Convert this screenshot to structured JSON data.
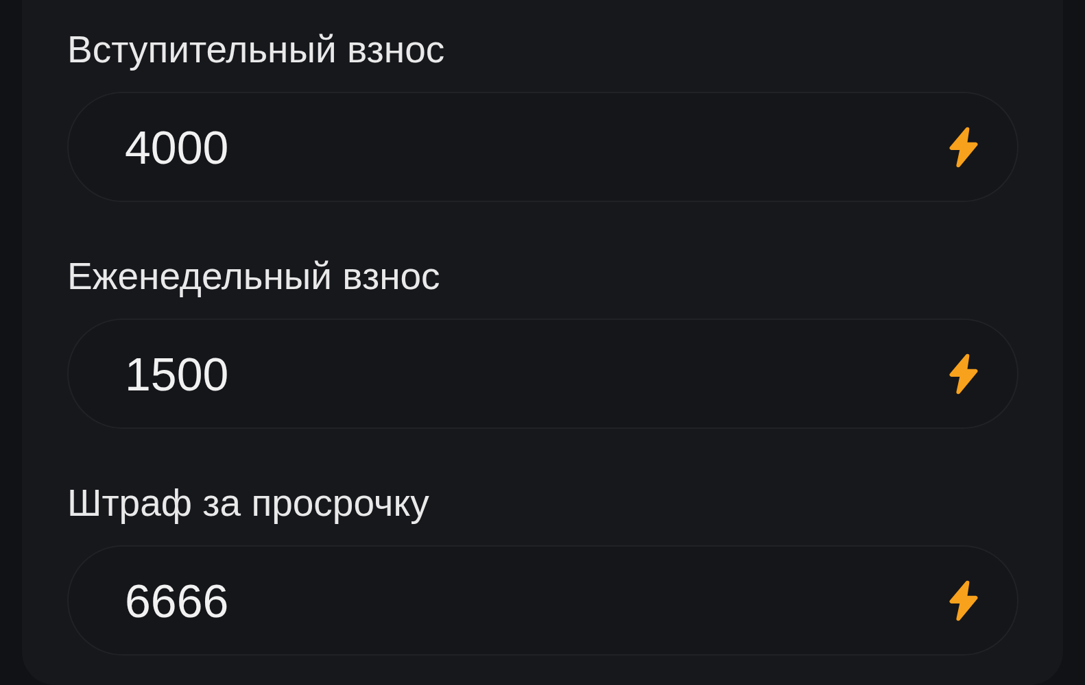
{
  "fields": [
    {
      "label": "Вступительный взнос",
      "value": "4000"
    },
    {
      "label": "Еженедельный взнос",
      "value": "1500"
    },
    {
      "label": "Штраф за просрочку",
      "value": "6666"
    }
  ]
}
